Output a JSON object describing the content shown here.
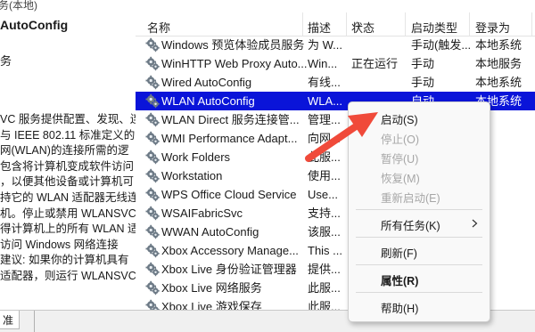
{
  "left_pane": {
    "breadcrumb": "务(本地)",
    "service_title": "AutoConfig",
    "section": "务",
    "description": "VC 服务提供配置、发现、连\n与 IEEE 802.11 标准定义的\n网(WLAN)的连接所需的逻\n包含将计算机变成软件访问\n，以便其他设备或计算机可\n持它的 WLAN 适配器无线连\n机。停止或禁用 WLANSVC\n得计算机上的所有 WLAN 适\n访问 Windows 网络连接\n建议: 如果你的计算机具有\n适配器，则运行 WLANSVC"
  },
  "columns": {
    "name": "名称",
    "description": "描述",
    "status": "状态",
    "startup_type": "启动类型",
    "logon_as": "登录为"
  },
  "services": [
    {
      "name": "Windows 预览体验成员服务",
      "desc": "为 W...",
      "status": "",
      "type": "手动(触发...",
      "logon": "本地系统",
      "selected": false
    },
    {
      "name": "WinHTTP Web Proxy Auto...",
      "desc": "Win...",
      "status": "正在运行",
      "type": "手动",
      "logon": "本地服务",
      "selected": false
    },
    {
      "name": "Wired AutoConfig",
      "desc": "有线...",
      "status": "",
      "type": "手动",
      "logon": "本地系统",
      "selected": false
    },
    {
      "name": "WLAN AutoConfig",
      "desc": "WLA...",
      "status": "",
      "type": "自动",
      "logon": "本地系统",
      "selected": true
    },
    {
      "name": "WLAN Direct 服务连接管...",
      "desc": "管理...",
      "status": "",
      "type": "",
      "logon": "",
      "selected": false
    },
    {
      "name": "WMI Performance Adapt...",
      "desc": "向网...",
      "status": "",
      "type": "",
      "logon": "",
      "selected": false
    },
    {
      "name": "Work Folders",
      "desc": "此服...",
      "status": "",
      "type": "",
      "logon": "",
      "selected": false
    },
    {
      "name": "Workstation",
      "desc": "使用...",
      "status": "",
      "type": "",
      "logon": "",
      "selected": false
    },
    {
      "name": "WPS Office Cloud Service",
      "desc": "Use...",
      "status": "",
      "type": "",
      "logon": "",
      "selected": false
    },
    {
      "name": "WSAIFabricSvc",
      "desc": "支持...",
      "status": "",
      "type": "",
      "logon": "",
      "selected": false
    },
    {
      "name": "WWAN AutoConfig",
      "desc": "该服...",
      "status": "",
      "type": "",
      "logon": "",
      "selected": false
    },
    {
      "name": "Xbox Accessory Manage...",
      "desc": "This ...",
      "status": "",
      "type": "",
      "logon": "",
      "selected": false
    },
    {
      "name": "Xbox Live 身份验证管理器",
      "desc": "提供...",
      "status": "",
      "type": "",
      "logon": "",
      "selected": false
    },
    {
      "name": "Xbox Live 网络服务",
      "desc": "此服...",
      "status": "",
      "type": "",
      "logon": "",
      "selected": false
    },
    {
      "name": "Xbox Live 游戏保存",
      "desc": "此服...",
      "status": "",
      "type": "",
      "logon": "",
      "selected": false
    }
  ],
  "context_menu": {
    "start": "启动(S)",
    "stop": "停止(O)",
    "pause": "暂停(U)",
    "resume": "恢复(M)",
    "restart": "重新启动(E)",
    "all_tasks": "所有任务(K)",
    "refresh": "刷新(F)",
    "properties": "属性(R)",
    "help": "帮助(H)"
  },
  "bottom_tab": "准",
  "colors": {
    "selection": "#0a14d9",
    "annotation_arrow": "#f04a3a",
    "disabled_text": "#a6a6a6"
  },
  "icons": {
    "service": "gear-icon",
    "submenu": "chevron-right-icon",
    "sort": "sort-ascending-icon",
    "annotation": "red-pointer-arrow-icon"
  }
}
